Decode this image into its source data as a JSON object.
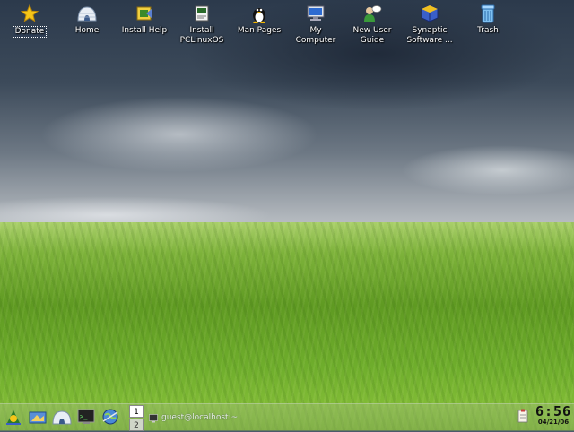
{
  "desktop": {
    "icons": [
      {
        "label": "Donate",
        "icon": "star-icon"
      },
      {
        "label": "Home",
        "icon": "home-igloo-icon"
      },
      {
        "label": "Install Help",
        "icon": "install-help-icon"
      },
      {
        "label": "Install\nPCLinuxOS",
        "icon": "install-pclinuxos-icon"
      },
      {
        "label": "Man Pages",
        "icon": "tux-penguin-icon"
      },
      {
        "label": "My\nComputer",
        "icon": "computer-icon"
      },
      {
        "label": "New User\nGuide",
        "icon": "user-guide-icon"
      },
      {
        "label": "Synaptic\nSoftware ...",
        "icon": "synaptic-package-icon"
      },
      {
        "label": "Trash",
        "icon": "trash-icon"
      }
    ]
  },
  "taskbar": {
    "launchers": [
      {
        "icon": "pclinuxos-menu-icon"
      },
      {
        "icon": "show-desktop-icon"
      },
      {
        "icon": "home-igloo-icon"
      },
      {
        "icon": "terminal-icon"
      },
      {
        "icon": "network-globe-icon"
      }
    ],
    "pager": {
      "desktops": [
        "1",
        "2"
      ],
      "active": "1"
    },
    "task": {
      "label": "guest@localhost:~",
      "icon": "terminal-icon"
    },
    "tray": {
      "icon": "clipboard-icon"
    },
    "clock": {
      "time": "6:56",
      "date": "04/21/06"
    }
  },
  "colors": {
    "icon_label": "#ffffff",
    "taskbar_tint": "#8fb060"
  }
}
